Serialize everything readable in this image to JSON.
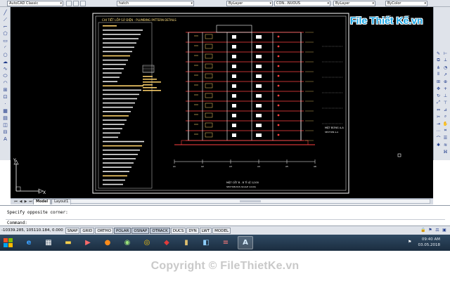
{
  "toolbar": {
    "workspace": "AutoCAD Classic",
    "hatch": "hatch",
    "layer": "ByLayer",
    "linetype": "CON...NUOUS",
    "lineweight": "ByLayer",
    "plotstyle": "ByColor"
  },
  "logo": {
    "text": "File Thiết Kế.vn"
  },
  "drawing": {
    "sheet_header": "CHI TIẾT LỐP SỬ ĐIỆN - PLUMBING PATTERN DETAILS",
    "detail_label_a": "MẶT ĐỨNG A-A",
    "detail_sub_a": "SECTION A-A",
    "detail_label_b": "MẶT CẮT B - B TỈ LỆ 1/100",
    "detail_sub_b": "SECTION B-B (SCALE 1/100)",
    "axis_labels": [
      "A1",
      "A2",
      "A3",
      "A4",
      "A5",
      "A6"
    ]
  },
  "tabs": {
    "model": "Model",
    "layout1": "Layout1"
  },
  "command": {
    "history": "Specify opposite corner:",
    "prompt": "Command:"
  },
  "status": {
    "coords": "-10339.285, 105110.184, 0.000",
    "buttons": [
      {
        "label": "SNAP",
        "on": false
      },
      {
        "label": "GRID",
        "on": false
      },
      {
        "label": "ORTHO",
        "on": false
      },
      {
        "label": "POLAR",
        "on": true
      },
      {
        "label": "OSNAP",
        "on": true
      },
      {
        "label": "OTRACK",
        "on": true
      },
      {
        "label": "DUCS",
        "on": false
      },
      {
        "label": "DYN",
        "on": false
      },
      {
        "label": "LWT",
        "on": false
      },
      {
        "label": "MODEL",
        "on": false
      }
    ]
  },
  "taskbar": {
    "time": "09:40 AM",
    "date": "03.05.2018"
  },
  "footer": {
    "copyright": "Copyright © FileThietKe.vn"
  }
}
